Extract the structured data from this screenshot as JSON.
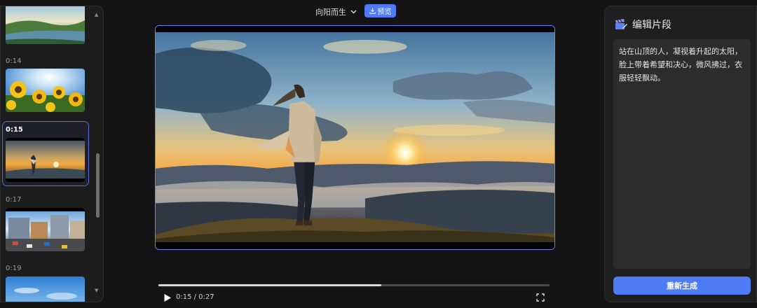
{
  "clips": [
    {
      "time": "",
      "active": false,
      "scene": "river"
    },
    {
      "time": "0:14",
      "active": false,
      "scene": "sunflowers"
    },
    {
      "time": "0:15",
      "active": true,
      "scene": "mountain-sunrise"
    },
    {
      "time": "0:17",
      "active": false,
      "scene": "city"
    },
    {
      "time": "0:19",
      "active": false,
      "scene": "sky"
    }
  ],
  "toolbar": {
    "voice_label": "向阳而生",
    "preview_label": "预览"
  },
  "player": {
    "current_time": "0:15",
    "total_time": "0:27",
    "time_display": "0:15 / 0:27",
    "progress": 0.57
  },
  "editor": {
    "title": "编辑片段",
    "text": "站在山顶的人，凝视着升起的太阳，脸上带着希望和决心，微风拂过，衣服轻轻飘动。",
    "regenerate_label": "重新生成"
  },
  "colors": {
    "accent": "#4f7bf6",
    "selection_border": "#6c82f0",
    "background": "#141414"
  }
}
